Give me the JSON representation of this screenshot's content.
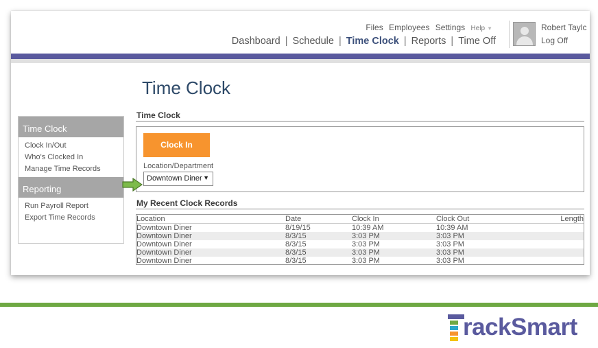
{
  "header": {
    "util_links": {
      "files": "Files",
      "employees": "Employees",
      "settings": "Settings",
      "help": "Help"
    },
    "nav": [
      {
        "label": "Dashboard"
      },
      {
        "label": "Schedule"
      },
      {
        "label": "Time Clock"
      },
      {
        "label": "Reports"
      },
      {
        "label": "Time Off"
      }
    ],
    "active_nav": "Time Clock",
    "user_name": "Robert Taylc",
    "logoff": "Log Off"
  },
  "page_title": "Time Clock",
  "sidebar": {
    "sections": [
      {
        "title": "Time Clock",
        "items": [
          "Clock In/Out",
          "Who's Clocked In",
          "Manage Time Records"
        ]
      },
      {
        "title": "Reporting",
        "items": [
          "Run Payroll Report",
          "Export Time Records"
        ]
      }
    ]
  },
  "time_clock": {
    "section_title": "Time Clock",
    "clock_in_label": "Clock In",
    "location_label": "Location/Department",
    "location_value": "Downtown Diner"
  },
  "records": {
    "section_title": "My Recent Clock Records",
    "columns": [
      "Location",
      "Date",
      "Clock In",
      "Clock Out",
      "Length"
    ],
    "rows": [
      [
        "Downtown Diner",
        "8/19/15",
        "10:39 AM",
        "10:39 AM",
        ""
      ],
      [
        "Downtown Diner",
        "8/3/15",
        "3:03 PM",
        "3:03 PM",
        ""
      ],
      [
        "Downtown Diner",
        "8/3/15",
        "3:03 PM",
        "3:03 PM",
        ""
      ],
      [
        "Downtown Diner",
        "8/3/15",
        "3:03 PM",
        "3:03 PM",
        ""
      ],
      [
        "Downtown Diner",
        "8/3/15",
        "3:03 PM",
        "3:03 PM",
        ""
      ]
    ]
  },
  "footer": {
    "logo_text": "rackSmart"
  },
  "colors": {
    "accent_purple": "#5a5a9e",
    "clock_button": "#f7942e",
    "green_rule": "#6ea843",
    "title_blue": "#2d4968"
  }
}
